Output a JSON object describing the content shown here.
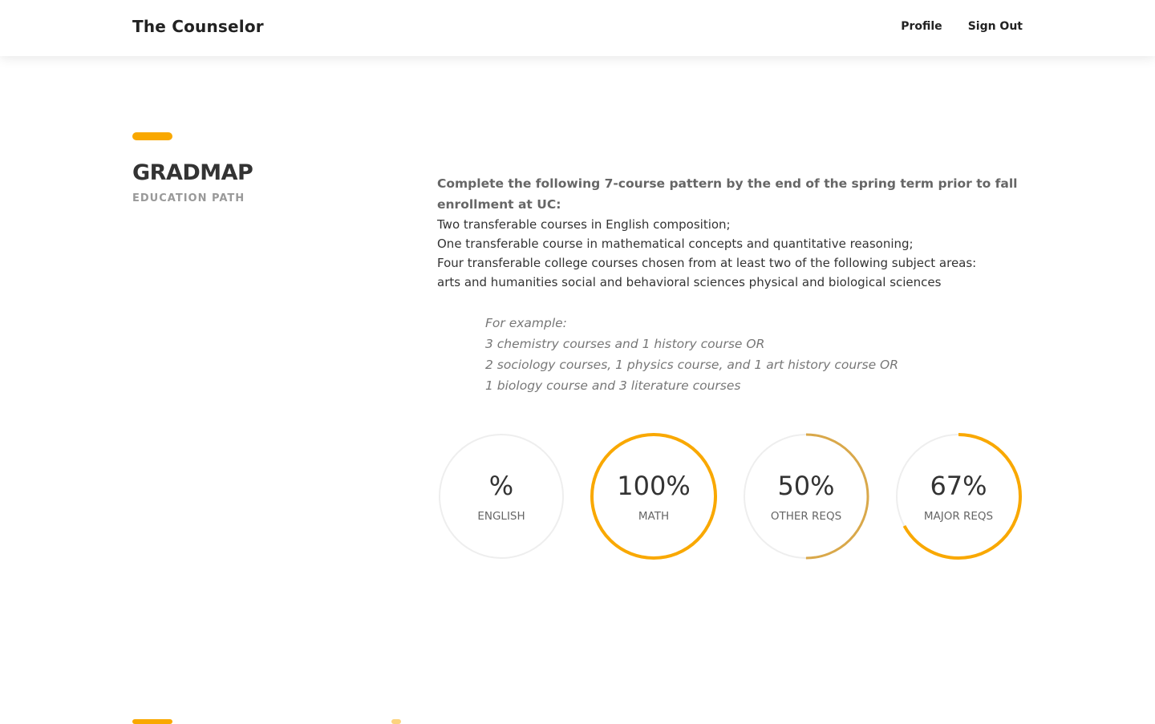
{
  "navbar": {
    "brand": "The Counselor",
    "links": [
      {
        "label": "Profile"
      },
      {
        "label": "Sign Out"
      }
    ]
  },
  "section": {
    "title": "GRADMAP",
    "subtitle": "EDUCATION PATH"
  },
  "content": {
    "intro": "Complete the following 7-course pattern by the end of the spring term prior to fall enrollment at UC:",
    "requirements": [
      "Two transferable courses in English composition;",
      "One transferable course in mathematical concepts and quantitative reasoning;",
      "Four transferable college courses chosen from at least two of the following subject areas:",
      "arts and humanities social and behavioral sciences physical and biological sciences"
    ],
    "examples": [
      "For example:",
      "3 chemistry courses and 1 history course OR",
      "2 sociology courses, 1 physics course, and 1 art history course OR",
      "1 biology course and 3 literature courses"
    ]
  },
  "progress": [
    {
      "value_text": "%",
      "label": "ENGLISH",
      "fraction": 0,
      "color": "#f9a800"
    },
    {
      "value_text": "100%",
      "label": "MATH",
      "fraction": 1.0,
      "color": "#f9a800"
    },
    {
      "value_text": "50%",
      "label": "OTHER REQS",
      "fraction": 0.5,
      "color": "#d9a84a"
    },
    {
      "value_text": "67%",
      "label": "MAJOR REQS",
      "fraction": 0.67,
      "color": "#f9a800"
    }
  ],
  "colors": {
    "accent": "#f9a800",
    "track": "#eeeeee"
  }
}
